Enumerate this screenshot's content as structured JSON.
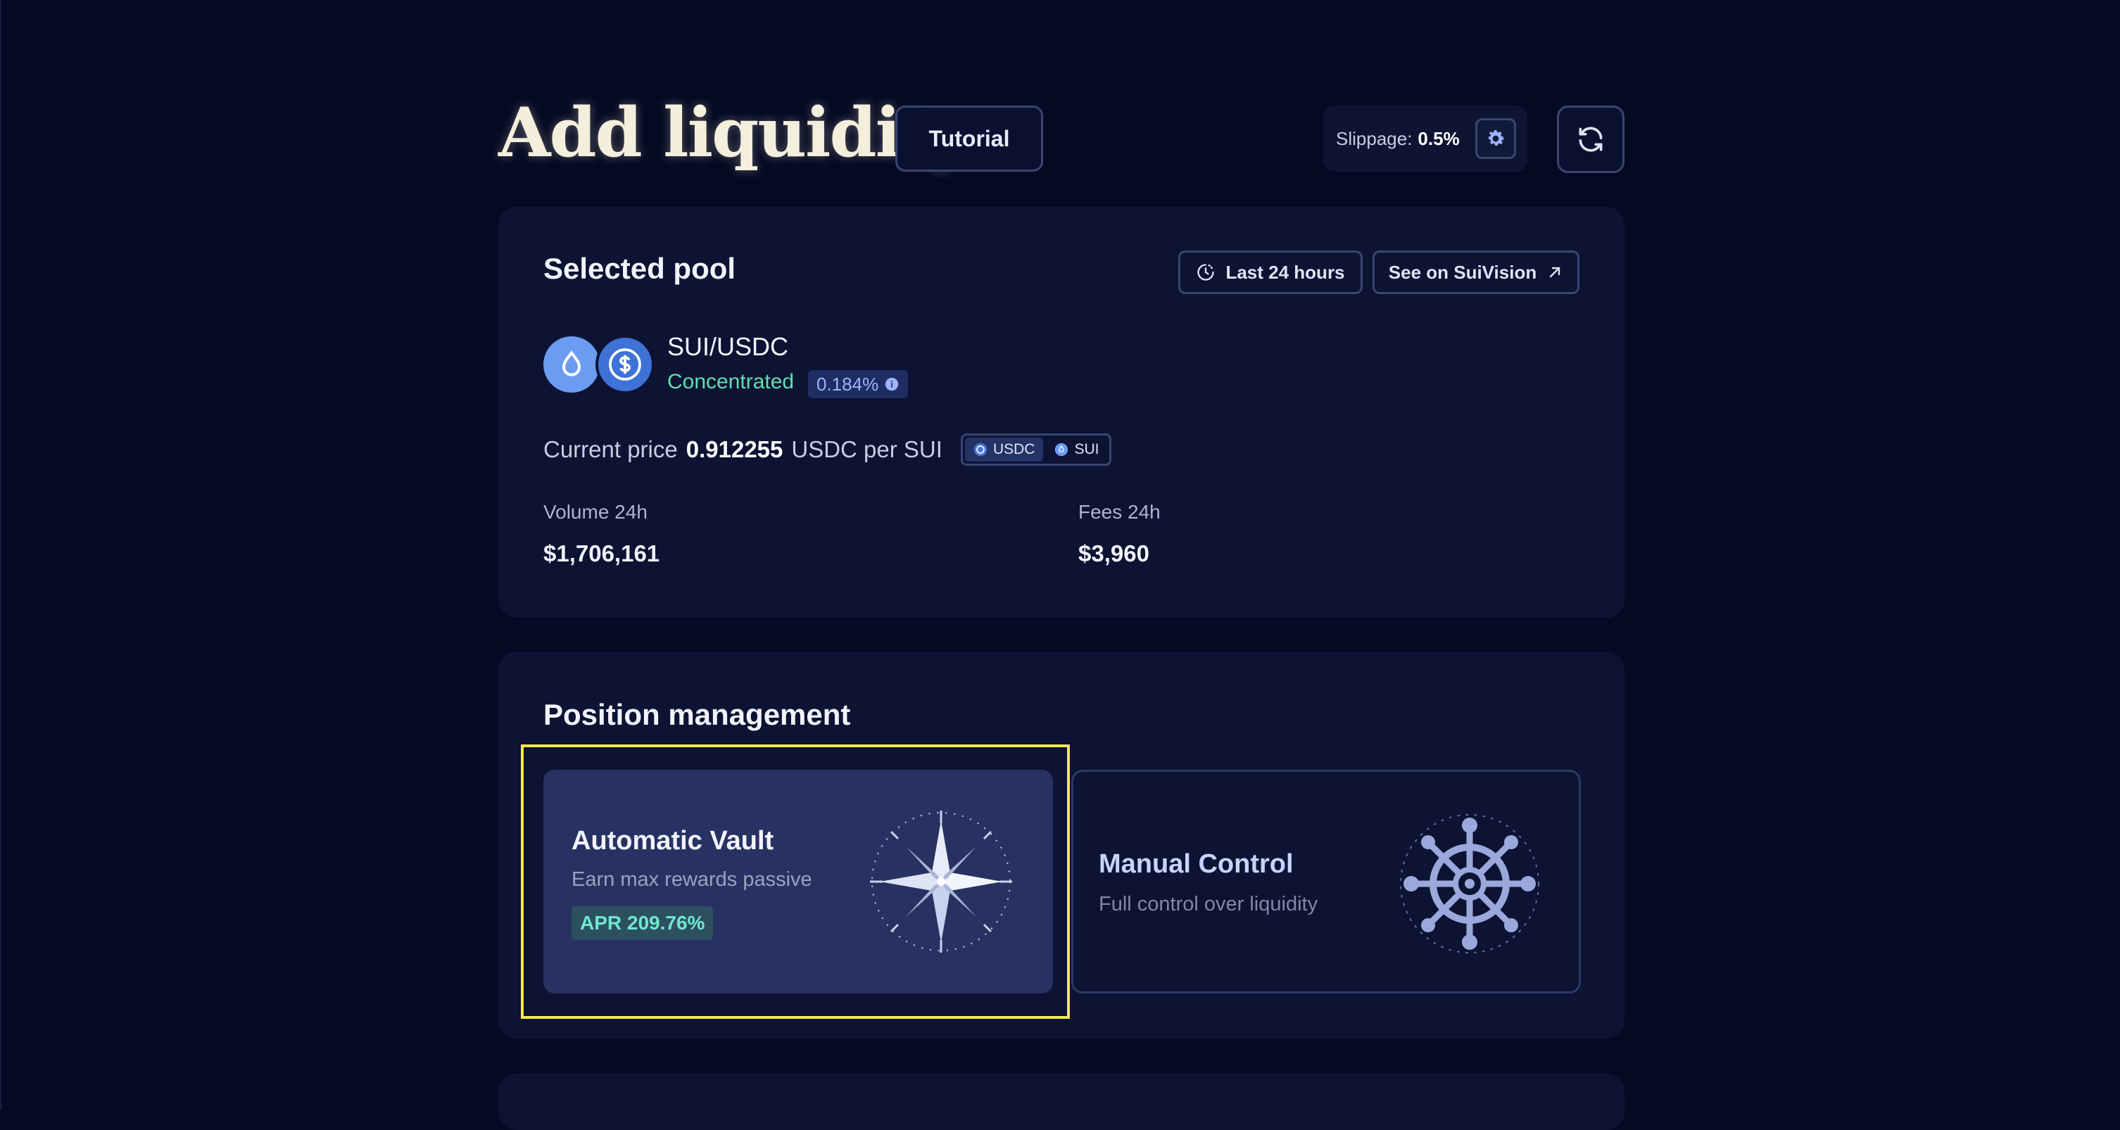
{
  "header": {
    "title": "Add liquidity",
    "tutorial_label": "Tutorial",
    "slippage_label": "Slippage:",
    "slippage_value": "0.5%"
  },
  "pool": {
    "section_title": "Selected pool",
    "time_range_label": "Last 24 hours",
    "explorer_label": "See on SuiVision",
    "pair": "SUI/USDC",
    "type": "Concentrated",
    "fee": "0.184%",
    "price_label": "Current price",
    "price_value": "0.912255",
    "price_unit": "USDC per SUI",
    "toggle_options": [
      "USDC",
      "SUI"
    ],
    "volume_label": "Volume 24h",
    "volume_value": "$1,706,161",
    "fees_label": "Fees 24h",
    "fees_value": "$3,960"
  },
  "position": {
    "section_title": "Position management",
    "options": [
      {
        "title": "Automatic Vault",
        "subtitle": "Earn max rewards passive",
        "badge": "APR 209.76%",
        "icon": "compass-icon",
        "selected": true
      },
      {
        "title": "Manual Control",
        "subtitle": "Full control over liquidity",
        "icon": "ship-wheel-icon",
        "selected": false
      }
    ]
  },
  "colors": {
    "background": "#050a24",
    "card": "#0c1333",
    "accent_green": "#5fe0b0",
    "accent_blue": "#9fb3ff",
    "highlight": "#f4e94a"
  }
}
